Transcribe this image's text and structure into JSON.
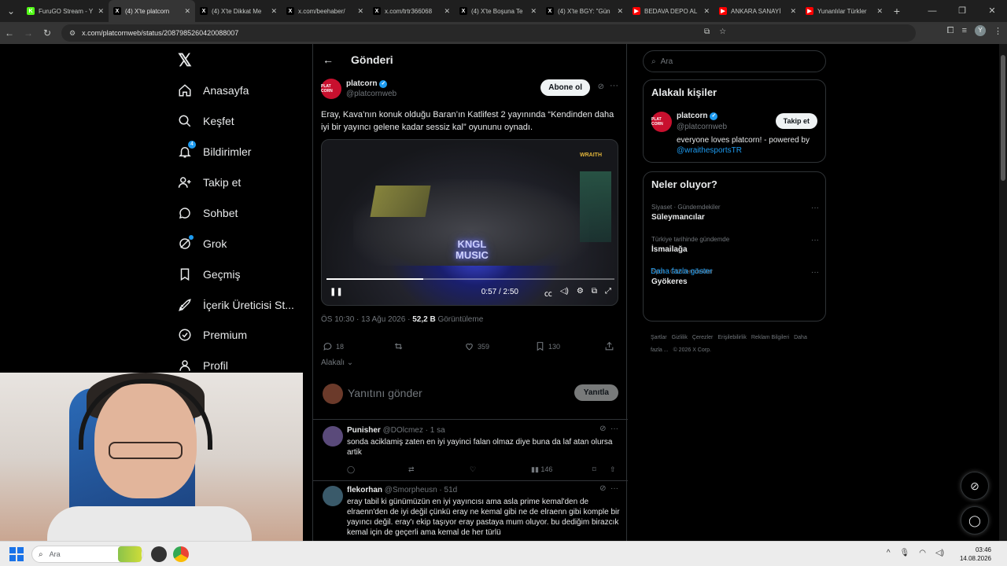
{
  "browser": {
    "tabs": [
      {
        "title": "FuruGO Stream - Y",
        "color": "#53fc18",
        "fav_text": "K"
      },
      {
        "title": "(4) X'te platcorn",
        "color": "#000000",
        "fav_text": "X",
        "active": true
      },
      {
        "title": "(4) X'te Dikkat Me",
        "color": "#000000",
        "fav_text": "X"
      },
      {
        "title": "x.com/beehaber/",
        "color": "#000000",
        "fav_text": "X"
      },
      {
        "title": "x.com/trtr366068",
        "color": "#000000",
        "fav_text": "X"
      },
      {
        "title": "(4) X'te Boşuna Te",
        "color": "#000000",
        "fav_text": "X"
      },
      {
        "title": "(4) X'te BGY: \"Gün",
        "color": "#000000",
        "fav_text": "X"
      },
      {
        "title": "BEDAVA DEPO AL",
        "color": "#ff0000",
        "fav_text": "▶"
      },
      {
        "title": "ANKARA SANAYİ",
        "color": "#ff0000",
        "fav_text": "▶"
      },
      {
        "title": "Yunanlılar Türkler",
        "color": "#ff0000",
        "fav_text": "▶"
      }
    ],
    "url": "x.com/platcornweb/status/2087985260420088007",
    "profile_initial": "Y"
  },
  "nav": {
    "items": [
      {
        "label": "Anasayfa",
        "icon": "home-icon"
      },
      {
        "label": "Keşfet",
        "icon": "search-icon"
      },
      {
        "label": "Bildirimler",
        "icon": "bell-icon",
        "badge": "4"
      },
      {
        "label": "Takip et",
        "icon": "follow-icon"
      },
      {
        "label": "Sohbet",
        "icon": "chat-icon"
      },
      {
        "label": "Grok",
        "icon": "grok-icon"
      },
      {
        "label": "Geçmiş",
        "icon": "bookmark-icon"
      },
      {
        "label": "İçerik Üreticisi St...",
        "icon": "rocket-icon"
      },
      {
        "label": "Premium",
        "icon": "premium-icon"
      },
      {
        "label": "Profil",
        "icon": "profile-icon"
      }
    ]
  },
  "main": {
    "title": "Gönderi",
    "post": {
      "name": "platcorn",
      "handle": "@platcornweb",
      "avatar_text": "PLAT CORN",
      "subscribe_label": "Abone ol",
      "text": "Eray, Kava’nın konuk olduğu Baran’ın Katlifest 2 yayınında “Kendinden daha iyi bir yayıncı gelene kadar sessiz kal” oyununu oynadı.",
      "video": {
        "brand": "WRAITH",
        "neon_line1": "KNGL",
        "neon_line2": "MUSIC",
        "time": "0:57 / 2:50",
        "progress": 0.335
      },
      "time": "ÖS 10:30 · 13 Ağu 2026 · ",
      "views": "52,2 B",
      "views_label": " Görüntüleme",
      "replies": "18",
      "likes": "359",
      "bookmarks": "130",
      "sort_label": "Alakalı"
    },
    "reply_placeholder": "Yanıtını gönder",
    "reply_button": "Yanıtla",
    "replies": [
      {
        "name": "Punisher",
        "handle": "@DOlcmez · 1 sa",
        "text": "sonda aciklamiş zaten en iyi yayinci falan olmaz diye buna da laf atan olursa artik",
        "views": "146"
      },
      {
        "name": "flekorhan",
        "handle": "@Smorpheusn · 51d",
        "text": "eray tabil ki  günümüzün en iyi yayıncısı ama asla prime kemal'den de elraenn'den de iyi değil çünkü eray ne kemal gibi ne de elraenn gibi komple bir yayıncı değil. eray'ı ekip taşıyor eray pastaya mum oluyor. bu dediğim birazcık kemal için de geçerli ama kemal de her türlü",
        "views": ""
      }
    ]
  },
  "sidebar": {
    "search_placeholder": "Ara",
    "people_title": "Alakalı kişiler",
    "person": {
      "name": "platcorn",
      "handle": "@platcornweb",
      "follow_label": "Takip et",
      "bio": "everyone loves platcorn! - powered by ",
      "bio_link": "@wraithesportsTR"
    },
    "trends_title": "Neler oluyor?",
    "trends": [
      {
        "category": "Siyaset · Gündemdekiler",
        "title": "Süleymancılar"
      },
      {
        "category": "Türkiye tarihinde gündemde",
        "title": "İsmailağa"
      },
      {
        "category": "Spor · Gündemdekiler",
        "title": "Gyökeres"
      }
    ],
    "show_more": "Daha fazla göster",
    "footer": [
      "Şartlar",
      "Gizlilik",
      "Çerezler",
      "Erişilebilirlik",
      "Reklam Bilgileri",
      "Daha fazla ...",
      "© 2026 X Corp."
    ]
  },
  "taskbar": {
    "search_placeholder": "Ara",
    "time": "03:46",
    "date": "14.08.2026"
  }
}
